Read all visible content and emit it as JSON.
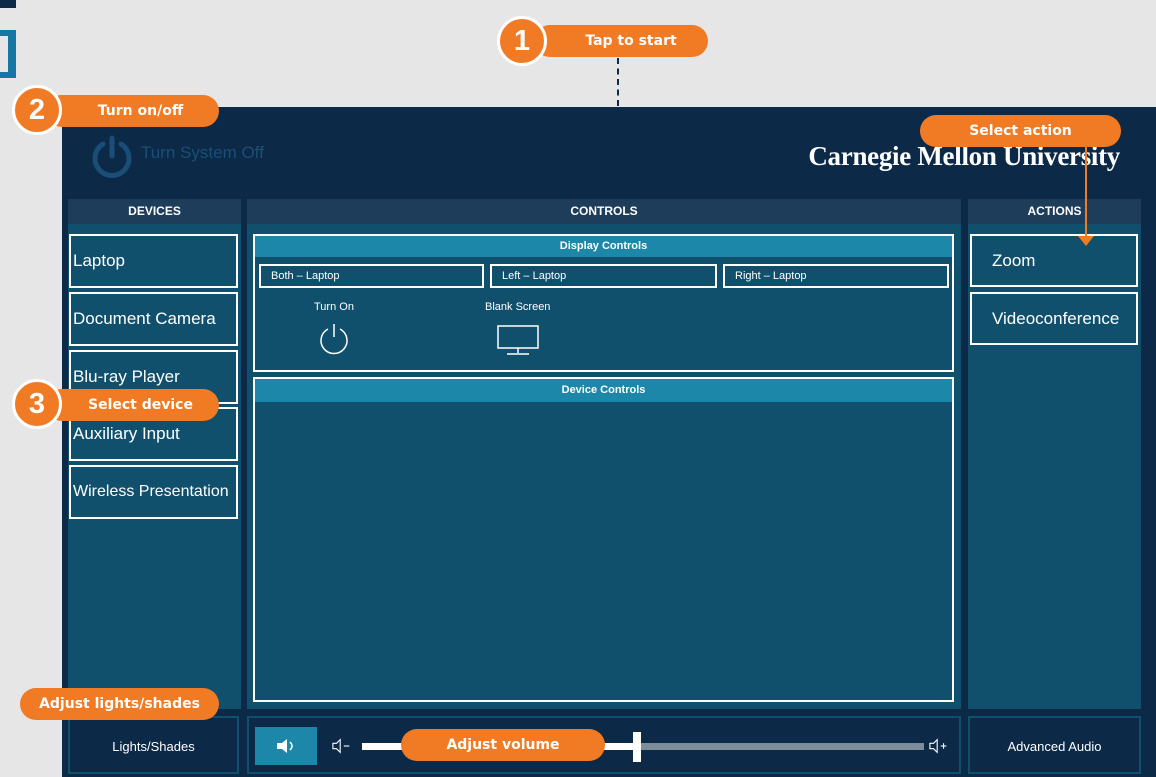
{
  "header": {
    "power_label": "Turn System Off",
    "brand": "Carnegie Mellon University"
  },
  "columns": {
    "devices": "DEVICES",
    "controls": "CONTROLS",
    "actions": "ACTIONS"
  },
  "devices": [
    "Laptop",
    "Document Camera",
    "Blu-ray Player",
    "Auxiliary Input",
    "Wireless Presentation"
  ],
  "display_controls": {
    "title": "Display Controls",
    "targets": [
      "Both – Laptop",
      "Left – Laptop",
      "Right – Laptop"
    ],
    "turn_on": "Turn On",
    "blank_screen": "Blank Screen"
  },
  "device_controls": {
    "title": "Device Controls"
  },
  "actions": [
    "Zoom",
    "Videoconference"
  ],
  "footer": {
    "lights": "Lights/Shades",
    "advanced_audio": "Advanced Audio",
    "volume_level": 0.49
  },
  "annotations": {
    "step1": {
      "number": "1",
      "label": "Tap to start"
    },
    "step2": {
      "number": "2",
      "label": "Turn on/off"
    },
    "step3": {
      "number": "3",
      "label": "Select device"
    },
    "select_action": "Select action",
    "adjust_lights": "Adjust lights/shades",
    "adjust_volume": "Adjust volume"
  },
  "colors": {
    "panel": "#0c2a47",
    "column": "#11506d",
    "accent": "#1c87a9",
    "annotation": "#f07b24"
  },
  "icons": [
    "power-icon",
    "monitor-icon",
    "speaker-icon",
    "volume-down-icon",
    "volume-up-icon"
  ]
}
